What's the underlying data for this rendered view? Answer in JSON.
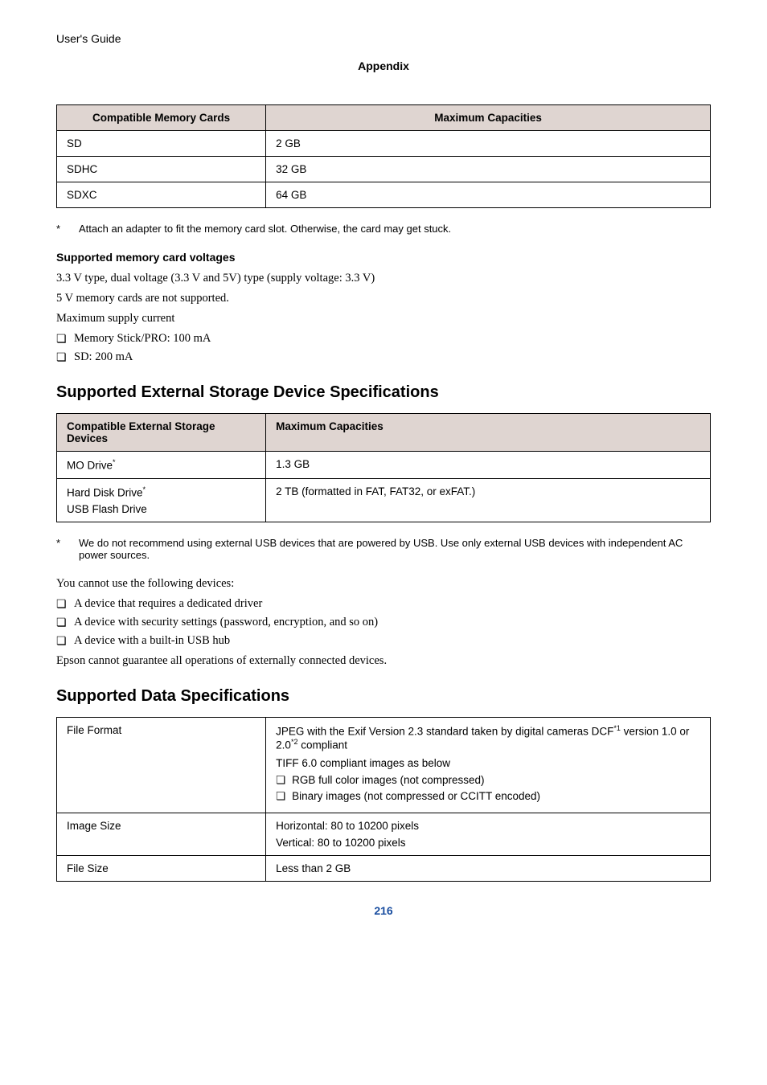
{
  "header": {
    "guide": "User's Guide",
    "section": "Appendix"
  },
  "table1": {
    "headers": [
      "Compatible Memory Cards",
      "Maximum Capacities"
    ],
    "rows": [
      [
        "SD",
        "2 GB"
      ],
      [
        "SDHC",
        "32 GB"
      ],
      [
        "SDXC",
        "64 GB"
      ]
    ]
  },
  "footnote1": {
    "marker": "*",
    "text": "Attach an adapter to fit the memory card slot. Otherwise, the card may get stuck."
  },
  "voltages": {
    "heading": "Supported memory card voltages",
    "lines": [
      "3.3 V type, dual voltage (3.3 V and 5V) type (supply voltage: 3.3 V)",
      "5 V memory cards are not supported.",
      "Maximum supply current"
    ],
    "bullets": [
      "Memory Stick/PRO: 100 mA",
      "SD: 200 mA"
    ]
  },
  "section2": {
    "heading": "Supported External Storage Device Specifications",
    "table": {
      "headers": [
        "Compatible External Storage Devices",
        "Maximum Capacities"
      ],
      "rows": [
        {
          "c1_pre": "MO Drive",
          "c1_sup": "*",
          "c2": "1.3 GB"
        },
        {
          "c1_line1_pre": "Hard Disk Drive",
          "c1_line1_sup": "*",
          "c1_line2": "USB Flash Drive",
          "c2": "2 TB (formatted in FAT, FAT32, or exFAT.)"
        }
      ]
    },
    "footnote": {
      "marker": "*",
      "text": "We do not recommend using external USB devices that are powered by USB. Use only external USB devices with independent AC power sources."
    },
    "para1": "You cannot use the following devices:",
    "bullets": [
      "A device that requires a dedicated driver",
      "A device with security settings (password, encryption, and so on)",
      "A device with a built-in USB hub"
    ],
    "para2": "Epson cannot guarantee all operations of externally connected devices."
  },
  "section3": {
    "heading": "Supported Data Specifications",
    "table": {
      "rows": [
        {
          "label": "File Format",
          "content": {
            "line1_pre": "JPEG with the Exif Version 2.3 standard taken by digital cameras DCF",
            "line1_sup1": "*1",
            "line1_mid": " version 1.0 or 2.0",
            "line1_sup2": "*2",
            "line1_post": " compliant",
            "line2": "TIFF 6.0 compliant images as below",
            "nested": [
              "RGB full color images (not compressed)",
              "Binary images (not compressed or CCITT encoded)"
            ]
          }
        },
        {
          "label": "Image Size",
          "content": {
            "line1": "Horizontal: 80 to 10200 pixels",
            "line2": "Vertical: 80 to 10200 pixels"
          }
        },
        {
          "label": "File Size",
          "content": {
            "line1": "Less than 2 GB"
          }
        }
      ]
    }
  },
  "pageNum": "216",
  "glyphs": {
    "bullet": "❏"
  }
}
